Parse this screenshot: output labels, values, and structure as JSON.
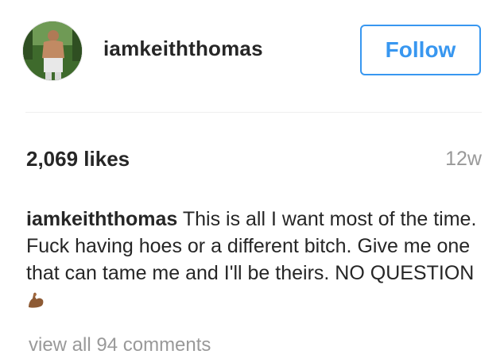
{
  "post": {
    "username": "iamkeiththomas",
    "follow_label": "Follow",
    "likes": "2,069 likes",
    "time_ago": "12w",
    "caption": {
      "username": "iamkeiththomas",
      "text": "This is all I want most of the time. Fuck having hoes or a different bitch. Give me one that can tame me and I'll be theirs. NO QUESTION",
      "emoji_icon": "flexed-biceps-icon"
    },
    "comments_link": "view all 94 comments"
  },
  "colors": {
    "accent": "#3897f0",
    "text": "#262626",
    "muted": "#999999",
    "divider": "#efefef"
  }
}
